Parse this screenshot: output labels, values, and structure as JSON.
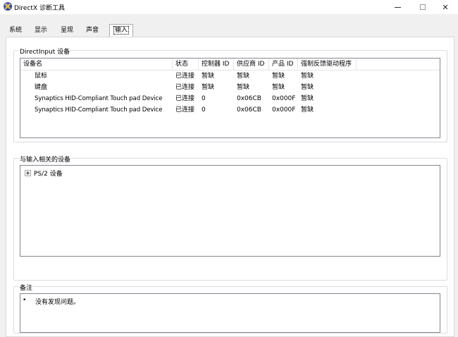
{
  "window": {
    "title": "DirectX 诊断工具",
    "close_glyph": "✕"
  },
  "tabs": [
    {
      "label": "系统"
    },
    {
      "label": "显示"
    },
    {
      "label": "呈现"
    },
    {
      "label": "声音"
    },
    {
      "label": "输入",
      "active": true
    }
  ],
  "directinput": {
    "group_title": "DirectInput 设备",
    "columns": [
      "设备名",
      "状态",
      "控制器 ID",
      "供应商 ID",
      "产品 ID",
      "强制反馈驱动程序"
    ],
    "rows": [
      [
        "鼠标",
        "已连接",
        "暂缺",
        "暂缺",
        "暂缺",
        "暂缺"
      ],
      [
        "键盘",
        "已连接",
        "暂缺",
        "暂缺",
        "暂缺",
        "暂缺"
      ],
      [
        "Synaptics HID-Compliant Touch pad Device",
        "已连接",
        "0",
        "0x06CB",
        "0x000F",
        "暂缺"
      ],
      [
        "Synaptics HID-Compliant Touch pad Device",
        "已连接",
        "0",
        "0x06CB",
        "0x000F",
        "暂缺"
      ]
    ]
  },
  "related": {
    "group_title": "与输入相关的设备",
    "items": [
      {
        "label": "PS/2 设备"
      }
    ]
  },
  "notes": {
    "group_title": "备注",
    "bullet": "•",
    "items": [
      "没有发现问题。"
    ]
  }
}
